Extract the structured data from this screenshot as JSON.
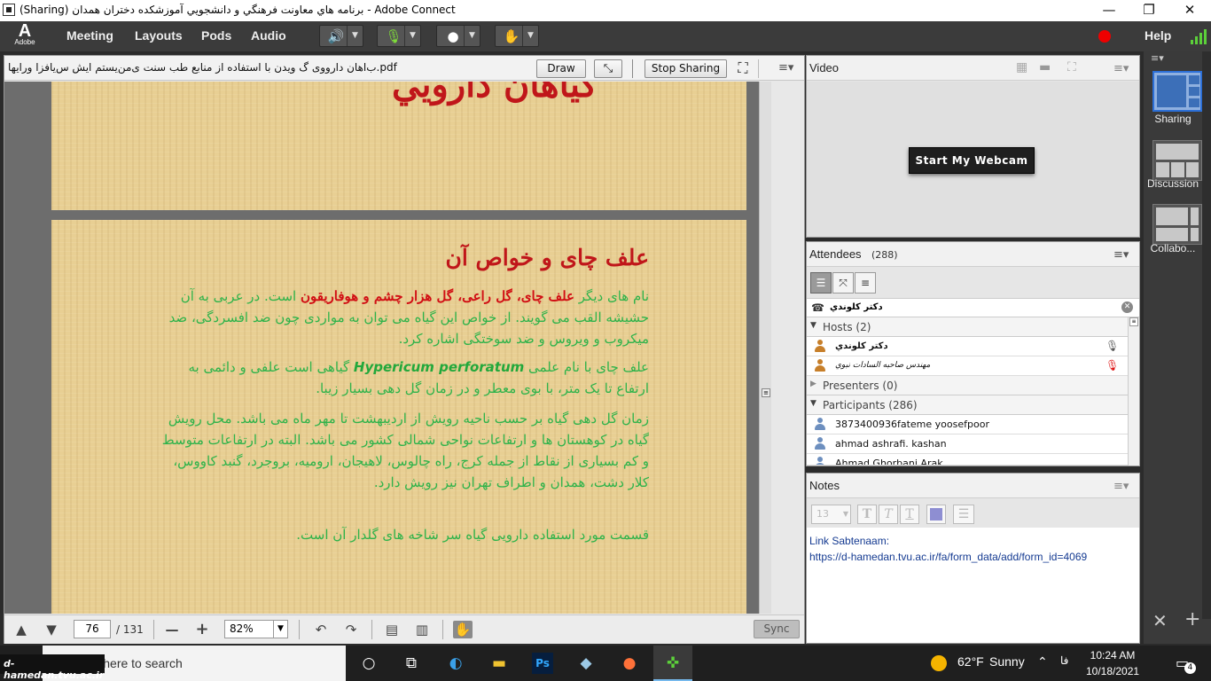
{
  "window": {
    "title": "(Sharing) برنامه هاي معاونت فرهنگي و دانشجويي آموزشكده دختران همدان - Adobe Connect",
    "minimize": "—",
    "restore": "❐",
    "close": "✕"
  },
  "menubar": {
    "logo_letter": "A",
    "logo_text": "Adobe",
    "items": [
      "Meeting",
      "Layouts",
      "Pods",
      "Audio"
    ],
    "help": "Help"
  },
  "share": {
    "filename": "ب‌اهان دارووی گ ویدن با استفاده از منابع طب سنت ی‌من‌یستم ایش س‌یافزا ورایها.pdf",
    "draw_label": "Draw",
    "stop_sharing_label": "Stop Sharing",
    "slide_prev_title": "گياهان دارويي",
    "slide": {
      "title": "علف چای و خواص آن",
      "p1_a": "نام های دیگر ",
      "p1_b": "علف چای، گل راعی، گل هزار چشم و هوفاریقون",
      "p1_c": " است. در عربی به آن حشیشه القب می گویند. از خواص این گیاه می توان به مواردی چون ضد افسردگی، ضد میکروب و ویروس و ضد سوختگی اشاره کرد.",
      "p2_a": "علف چای با نام علمی ",
      "p2_b": "Hypericum perforatum",
      "p2_c": " گیاهی است علفی و دائمی به ارتفاع تا یک متر، با بوی معطر و در زمان گل دهی بسیار زیبا.",
      "p3": "زمان گل دهی گیاه بر حسب ناحیه رویش از اردیبهشت تا مهر ماه می باشد. محل رویش گیاه در کوهستان ها و ارتفاعات نواحی شمالی کشور می باشد. البته در ارتفاعات متوسط و کم بسیاری از نقاط از جمله کرج، راه چالوس، لاهیجان، ارومیه، بروجرد، گنبد کاووس، کلار دشت، همدان و اطراف تهران نیز رویش دارد.",
      "p4": "قسمت مورد استفاده دارویی گیاه سر شاخه های گلدار آن است."
    },
    "page_current": "76",
    "page_total": "/ 131",
    "zoom": "82%",
    "sync_label": "Sync"
  },
  "video": {
    "title": "Video",
    "webcam_label": "Start My Webcam"
  },
  "attendees": {
    "title": "Attendees",
    "count": "(288)",
    "speaking": "دكتر  كلوندي",
    "hosts_label": "Hosts (2)",
    "hosts": [
      "دكتر  كلوندي",
      "مهندس صاحبه السادات نبوي"
    ],
    "presenters_label": "Presenters (0)",
    "participants_label": "Participants (286)",
    "participants": [
      "3873400936fateme yoosefpoor",
      "ahmad ashrafi. kashan",
      "Ahmad Ghorbani Arak"
    ]
  },
  "notes": {
    "title": "Notes",
    "font_size": "13",
    "line1": "Link Sabtenaam:",
    "line2": "https://d-hamedan.tvu.ac.ir/fa/form_data/add/form_id=4069"
  },
  "layouts": [
    "Sharing",
    "Discussion",
    "Collabo..."
  ],
  "taskbar": {
    "watermark": "d-hamedan.tvu.ac.ir",
    "search_placeholder": "Type here to search",
    "weather_temp": "62°F",
    "weather_text": "Sunny",
    "lang": "فا",
    "time": "10:24 AM",
    "date": "10/18/2021",
    "notifications": "4"
  }
}
